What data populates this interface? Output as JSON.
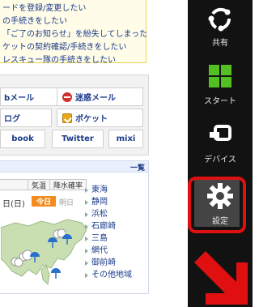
{
  "notices": [
    "ードを登録/変更したい",
    "の手続きをしたい",
    "「ご了のお知らせ」を紛失してしまった",
    "ケットの契約確認/手続きをしたい",
    "レスキュー隊の手続きをしたい"
  ],
  "services": {
    "webmail": "bメール",
    "spam": "迷惑メール",
    "blog": "ログ",
    "pocket": "ポケット",
    "facebook": "book",
    "twitter": "Twitter",
    "mixi": "mixi"
  },
  "weather": {
    "more": "一覧",
    "tabs": [
      "気温",
      "降水確率"
    ],
    "date": "日(日)",
    "today": "今日",
    "tomorrow": "明日",
    "regions": [
      "東海",
      "静岡",
      "浜松",
      "石廊崎",
      "三島",
      "網代",
      "御前崎",
      "その他地域"
    ]
  },
  "charms": {
    "share": "共有",
    "start": "スタート",
    "devices": "デバイス",
    "settings": "設定"
  },
  "colors": {
    "charm_bg": "#121212",
    "highlight": "#dd1111",
    "arrow": "#e01010",
    "start_green": "#53c022",
    "link": "#1a3a8a"
  }
}
